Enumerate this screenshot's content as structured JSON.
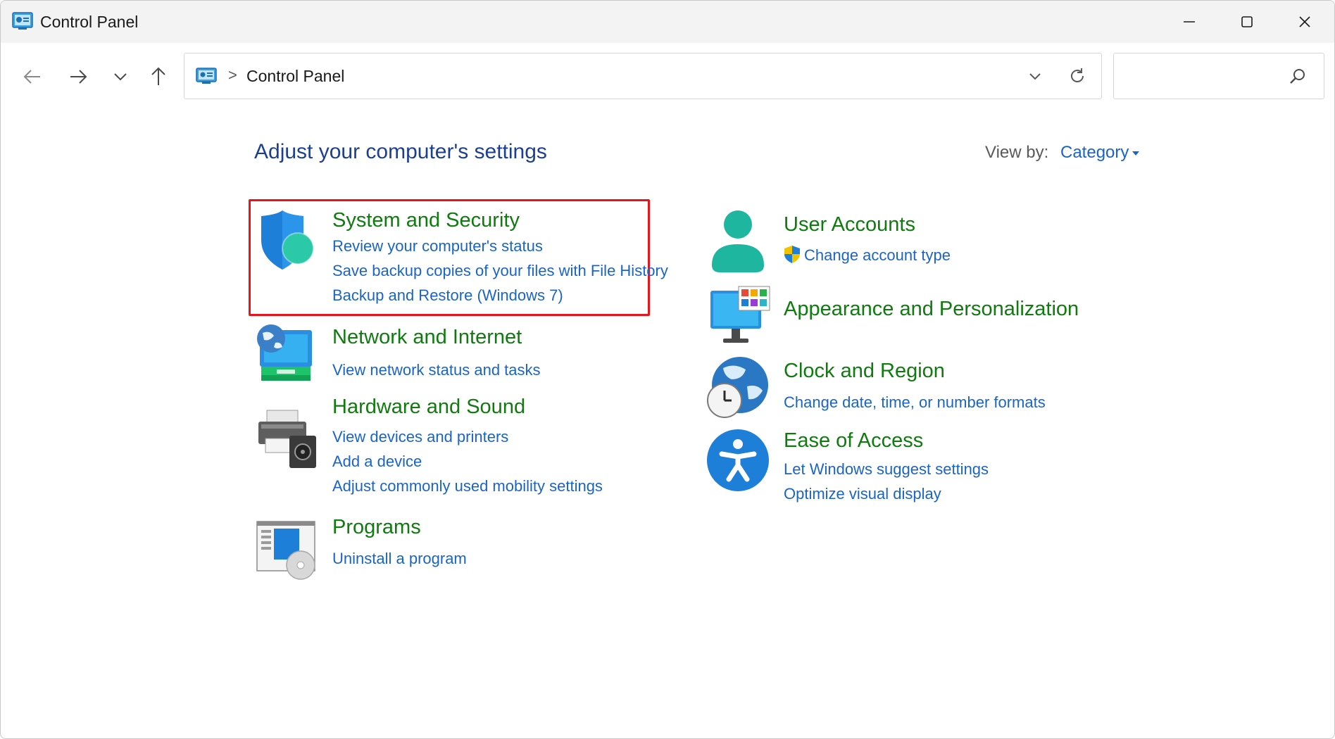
{
  "window": {
    "title": "Control Panel",
    "icon": "control-panel-icon"
  },
  "titlebar": {
    "minimize_icon": "minimize-icon",
    "maximize_icon": "maximize-icon",
    "close_icon": "close-icon"
  },
  "nav": {
    "back_icon": "arrow-left-icon",
    "forward_icon": "arrow-right-icon",
    "recent_icon": "chevron-down-icon",
    "up_icon": "arrow-up-icon"
  },
  "address": {
    "separator": ">",
    "location": "Control Panel"
  },
  "search": {
    "value": "",
    "placeholder": ""
  },
  "page": {
    "title": "Adjust your computer's settings",
    "view_by_label": "View by:",
    "view_by_value": "Category"
  },
  "categories_left": [
    {
      "title": "System and Security",
      "icon": "shield-icon",
      "links": [
        "Review your computer's status",
        "Save backup copies of your files with File History",
        "Backup and Restore (Windows 7)"
      ]
    },
    {
      "title": "Network and Internet",
      "icon": "network-globe-icon",
      "links": [
        "View network status and tasks"
      ]
    },
    {
      "title": "Hardware and Sound",
      "icon": "printer-speaker-icon",
      "links": [
        "View devices and printers",
        "Add a device",
        "Adjust commonly used mobility settings"
      ]
    },
    {
      "title": "Programs",
      "icon": "programs-disc-icon",
      "links": [
        "Uninstall a program"
      ]
    }
  ],
  "categories_right": [
    {
      "title": "User Accounts",
      "icon": "user-icon",
      "links": [
        "Change account type"
      ]
    },
    {
      "title": "Appearance and Personalization",
      "icon": "monitor-palette-icon",
      "links": []
    },
    {
      "title": "Clock and Region",
      "icon": "globe-clock-icon",
      "links": [
        "Change date, time, or number formats"
      ]
    },
    {
      "title": "Ease of Access",
      "icon": "accessibility-icon",
      "links": [
        "Let Windows suggest settings",
        "Optimize visual display"
      ]
    }
  ],
  "colors": {
    "category_title": "#0f7b0f",
    "link": "#1a64c8",
    "page_title": "#1d3f8f",
    "highlight": "#e8141c"
  }
}
